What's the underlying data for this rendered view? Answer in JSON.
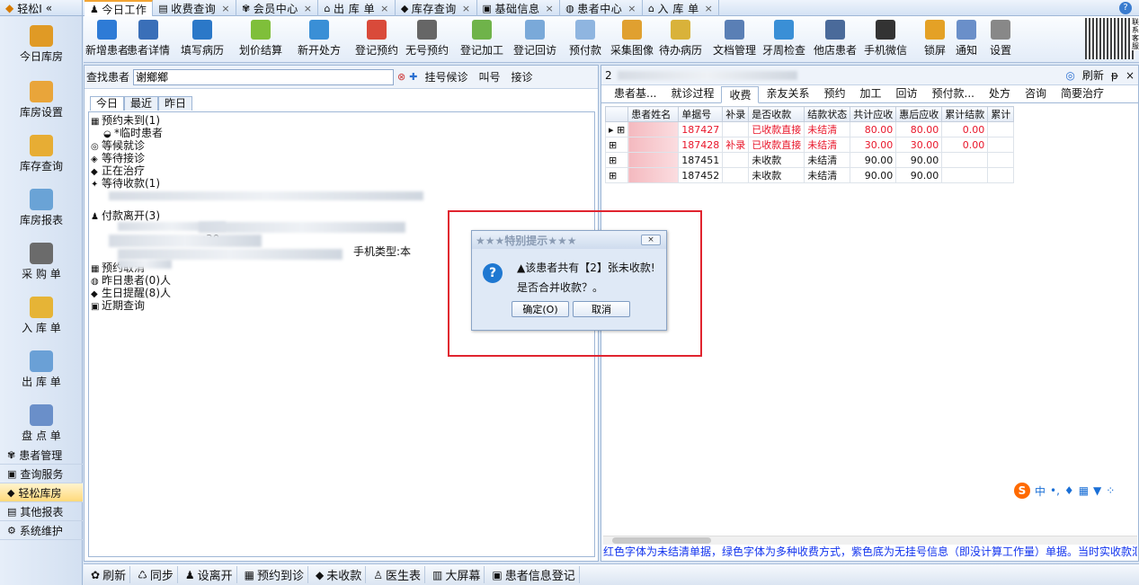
{
  "brand": {
    "label": "轻松I",
    "collapse": "«"
  },
  "tabs": [
    {
      "label": "今日工作",
      "icon": "♟",
      "active": true,
      "closable": false
    },
    {
      "label": "收费查询",
      "icon": "▤",
      "closable": true
    },
    {
      "label": "会员中心",
      "icon": "✾",
      "closable": true
    },
    {
      "label": "出 库 单",
      "icon": "⌂",
      "closable": true
    },
    {
      "label": "库存查询",
      "icon": "◆",
      "closable": true
    },
    {
      "label": "基础信息",
      "icon": "▣",
      "closable": true
    },
    {
      "label": "患者中心",
      "icon": "◍",
      "closable": true
    },
    {
      "label": "入 库 单",
      "icon": "⌂",
      "closable": true
    }
  ],
  "tab_close": "×",
  "help": "?",
  "leftnav": [
    {
      "label": "今日库房",
      "color": "#e09a25"
    },
    {
      "label": "库房设置",
      "color": "#e9a53a"
    },
    {
      "label": "库存查询",
      "color": "#e7ad34"
    },
    {
      "label": "库房报表",
      "color": "#6aa3d6"
    },
    {
      "label": "采 购 单",
      "color": "#6b6b6b"
    },
    {
      "label": "入 库 单",
      "color": "#e6b436"
    },
    {
      "label": "出 库 单",
      "color": "#6aa0d6"
    },
    {
      "label": "盘 点 单",
      "color": "#6a8fc9"
    }
  ],
  "navlist": [
    {
      "label": "患者管理",
      "icon": "✾"
    },
    {
      "label": "查询服务",
      "icon": "▣"
    },
    {
      "label": "轻松库房",
      "icon": "◆",
      "selected": true
    },
    {
      "label": "其他报表",
      "icon": "▤"
    },
    {
      "label": "系统维护",
      "icon": "⚙"
    }
  ],
  "toolbar": [
    "新增患者",
    "患者详情",
    "填写病历",
    "划价结算",
    "新开处方",
    "登记预约",
    "无号预约",
    "登记加工",
    "登记回访",
    "预付款",
    "采集图像",
    "待办病历",
    "文档管理",
    "牙周检查",
    "他店患者",
    "手机微信",
    "锁屏",
    "通知",
    "设置"
  ],
  "qr_caption": "联系客服",
  "search": {
    "label": "查找患者",
    "value": "谢鄉鄉",
    "buttons": [
      "挂号候诊",
      "叫号",
      "接诊"
    ]
  },
  "date_tabs": [
    "今日",
    "最近",
    "昨日"
  ],
  "tree": [
    {
      "text": "预约未到(1)",
      "icon": "▦"
    },
    {
      "text": "*临时患者",
      "icon": "◒",
      "indent": 1
    },
    {
      "text": "等候就诊",
      "icon": "◎"
    },
    {
      "text": "等待接诊",
      "icon": "◈"
    },
    {
      "text": "正在治疗",
      "icon": "◆"
    },
    {
      "text": "等待收款(1)",
      "icon": "✦"
    },
    {
      "text": "付款离开(3)",
      "icon": "♟"
    },
    {
      "text": ":30",
      "icon": "",
      "indent": 8
    },
    {
      "text": "手机类型:本",
      "icon": "",
      "indent": 20
    },
    {
      "text": "预约取消",
      "icon": "▦"
    },
    {
      "text": "昨日患者(0)人",
      "icon": "◍"
    },
    {
      "text": "生日提醒(8)人",
      "icon": "◆"
    },
    {
      "text": "近期查询",
      "icon": "▣"
    }
  ],
  "right": {
    "header_id": "2",
    "refresh": "刷新",
    "pin": "ᵽ",
    "close": "×",
    "tabs": [
      "患者基...",
      "就诊过程",
      "收费",
      "亲友关系",
      "预约",
      "加工",
      "回访",
      "预付款...",
      "处方",
      "咨询",
      "简要治疗"
    ],
    "active_tab": "收费",
    "columns": [
      "",
      "患者姓名",
      "单据号",
      "补录",
      "是否收款",
      "结款状态",
      "共计应收",
      "惠后应收",
      "累计结款",
      "累计"
    ],
    "rows": [
      {
        "marker": "▸",
        "expand": "⊞",
        "name": "",
        "bill": "187427",
        "supp": "",
        "paid": "已收款直接",
        "status": "未结清",
        "total": "80.00",
        "disc": "80.00",
        "settled": "0.00",
        "red": true
      },
      {
        "marker": "",
        "expand": "⊞",
        "name": "",
        "bill": "187428",
        "supp": "补录",
        "paid": "已收款直接",
        "status": "未结清",
        "total": "30.00",
        "disc": "30.00",
        "settled": "0.00",
        "red": true
      },
      {
        "marker": "",
        "expand": "⊞",
        "name": "",
        "bill": "187451",
        "supp": "",
        "paid": "未收款",
        "status": "未结清",
        "total": "90.00",
        "disc": "90.00",
        "settled": "",
        "red": false
      },
      {
        "marker": "",
        "expand": "⊞",
        "name": "",
        "bill": "187452",
        "supp": "",
        "paid": "未收款",
        "status": "未结清",
        "total": "90.00",
        "disc": "90.00",
        "settled": "",
        "red": false
      }
    ],
    "legend": "红色字体为未结清单据，绿色字体为多种收费方式，紫色底为无挂号信息（即没计算工作量）单据。当时实收款汇总"
  },
  "bottombar": [
    {
      "label": "刷新",
      "icon": "✿"
    },
    {
      "label": "同步",
      "icon": "♺"
    },
    {
      "label": "设离开",
      "icon": "♟"
    },
    {
      "label": "预约到诊",
      "icon": "▦"
    },
    {
      "label": "未收款",
      "icon": "◆"
    },
    {
      "label": "医生表",
      "icon": "♙"
    },
    {
      "label": "大屏幕",
      "icon": "▥"
    },
    {
      "label": "患者信息登记",
      "icon": "▣"
    }
  ],
  "ime": {
    "logo": "S",
    "lang": "中",
    "items": [
      "•,",
      "♦",
      "▦",
      "▼",
      "⁘"
    ]
  },
  "dialog": {
    "title": "★★★特别提示★★★",
    "close": "×",
    "icon": "?",
    "line1": "▲该患者共有【2】张未收款!",
    "line2": "是否合并收款？。",
    "ok": "确定(O)",
    "cancel": "取消"
  }
}
